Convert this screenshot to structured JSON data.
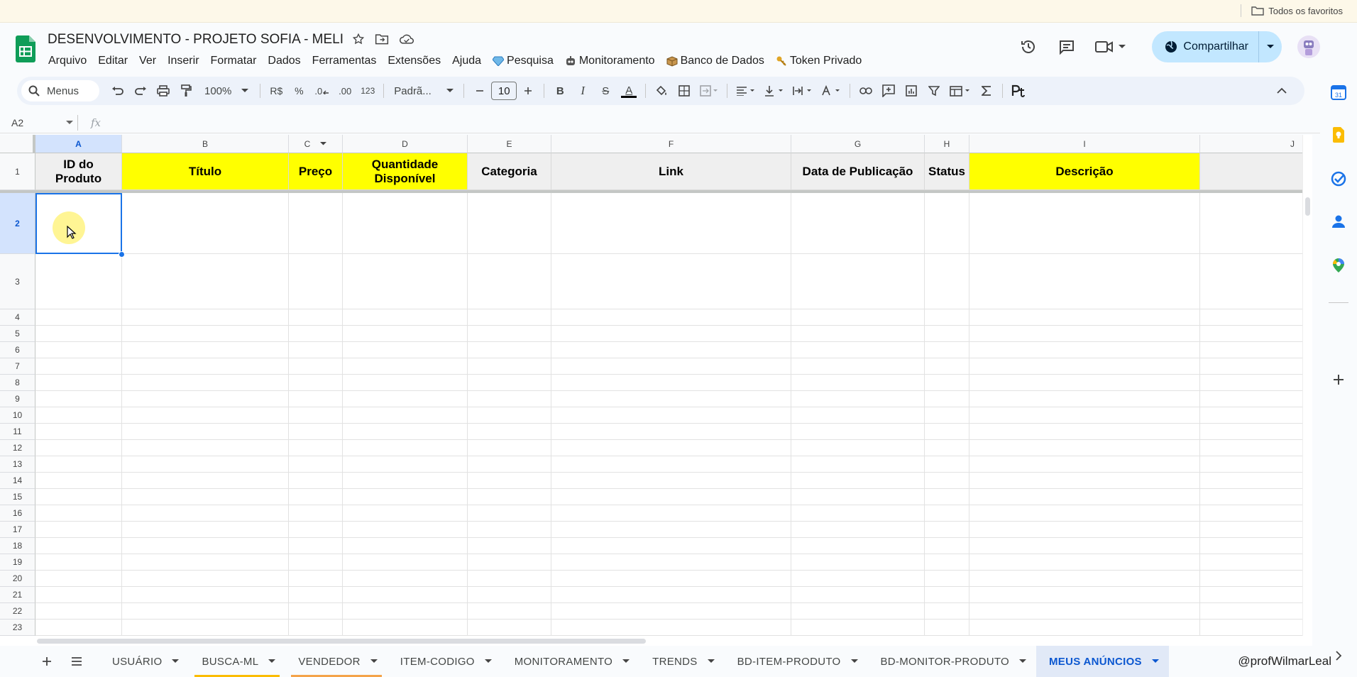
{
  "favorites_bar": {
    "label": "Todos os favoritos"
  },
  "doc": {
    "title": "DESENVOLVIMENTO - PROJETO SOFIA - MELI"
  },
  "menu": {
    "items": [
      "Arquivo",
      "Editar",
      "Ver",
      "Inserir",
      "Formatar",
      "Dados",
      "Ferramentas",
      "Extensões",
      "Ajuda"
    ],
    "custom": [
      {
        "label": "Pesquisa",
        "icon": "gem-icon"
      },
      {
        "label": "Monitoramento",
        "icon": "robot-icon"
      },
      {
        "label": "Banco de Dados",
        "icon": "box-icon"
      },
      {
        "label": "Token Privado",
        "icon": "key-icon"
      }
    ]
  },
  "header": {
    "share_label": "Compartilhar"
  },
  "toolbar": {
    "search_placeholder": "Menus",
    "zoom": "100%",
    "currency": "R$",
    "percent": "%",
    "dec_less": ".0",
    "dec_more": ".00",
    "number_format": "123",
    "font": "Padrã...",
    "font_size": "10",
    "bold": "B",
    "italic": "I",
    "strike": "S",
    "text_color": "A"
  },
  "formula_bar": {
    "cell_ref": "A2",
    "fx": "fx",
    "value": ""
  },
  "columns": [
    "A",
    "B",
    "C",
    "D",
    "E",
    "F",
    "G",
    "H",
    "I",
    "J"
  ],
  "rows": [
    "1",
    "2",
    "3",
    "4",
    "5",
    "6",
    "7",
    "8",
    "9",
    "10",
    "11",
    "12",
    "13",
    "14",
    "15",
    "16",
    "17",
    "18",
    "19",
    "20",
    "21",
    "22",
    "23"
  ],
  "header_row": [
    {
      "col": "A",
      "text": "ID do Produto",
      "fill": "#efefef"
    },
    {
      "col": "B",
      "text": "Título",
      "fill": "#ffff00"
    },
    {
      "col": "C",
      "text": "Preço",
      "fill": "#ffff00"
    },
    {
      "col": "D",
      "text": "Quantidade Disponível",
      "fill": "#ffff00"
    },
    {
      "col": "E",
      "text": "Categoria",
      "fill": "#efefef"
    },
    {
      "col": "F",
      "text": "Link",
      "fill": "#efefef"
    },
    {
      "col": "G",
      "text": "Data de Publicação",
      "fill": "#efefef"
    },
    {
      "col": "H",
      "text": "Status",
      "fill": "#efefef"
    },
    {
      "col": "I",
      "text": "Descrição",
      "fill": "#ffff00"
    },
    {
      "col": "J",
      "text": "",
      "fill": "#efefef"
    }
  ],
  "selected_cell": "A2",
  "sheets": [
    {
      "name": "USUÁRIO",
      "underline": ""
    },
    {
      "name": "BUSCA-ML",
      "underline": "#fbbc04"
    },
    {
      "name": "VENDEDOR",
      "underline": "#f4a34a"
    },
    {
      "name": "ITEM-CODIGO",
      "underline": ""
    },
    {
      "name": "MONITORAMENTO",
      "underline": ""
    },
    {
      "name": "TRENDS",
      "underline": ""
    },
    {
      "name": "BD-ITEM-PRODUTO",
      "underline": ""
    },
    {
      "name": "BD-MONITOR-PRODUTO",
      "underline": ""
    },
    {
      "name": "MEUS ANÚNCIOS",
      "underline": "",
      "active": true
    }
  ],
  "credit": "@profWilmarLeal",
  "colors": {
    "accent": "#1a73e8",
    "yellow_header": "#ffff00",
    "share_bg": "#c2e7ff"
  }
}
